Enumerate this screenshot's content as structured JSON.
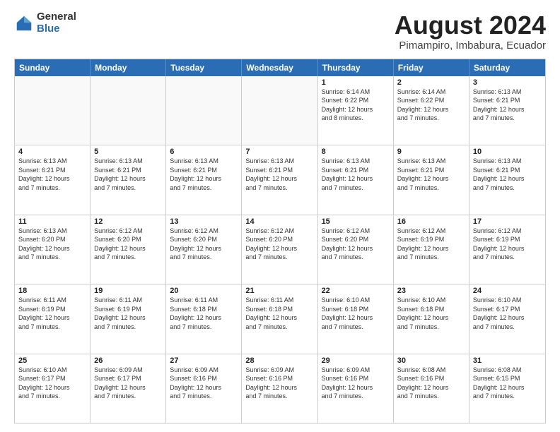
{
  "logo": {
    "general": "General",
    "blue": "Blue"
  },
  "title": "August 2024",
  "subtitle": "Pimampiro, Imbabura, Ecuador",
  "header_days": [
    "Sunday",
    "Monday",
    "Tuesday",
    "Wednesday",
    "Thursday",
    "Friday",
    "Saturday"
  ],
  "weeks": [
    [
      {
        "day": "",
        "lines": [],
        "empty": true
      },
      {
        "day": "",
        "lines": [],
        "empty": true
      },
      {
        "day": "",
        "lines": [],
        "empty": true
      },
      {
        "day": "",
        "lines": [],
        "empty": true
      },
      {
        "day": "1",
        "lines": [
          "Sunrise: 6:14 AM",
          "Sunset: 6:22 PM",
          "Daylight: 12 hours",
          "and 8 minutes."
        ],
        "empty": false
      },
      {
        "day": "2",
        "lines": [
          "Sunrise: 6:14 AM",
          "Sunset: 6:22 PM",
          "Daylight: 12 hours",
          "and 7 minutes."
        ],
        "empty": false
      },
      {
        "day": "3",
        "lines": [
          "Sunrise: 6:13 AM",
          "Sunset: 6:21 PM",
          "Daylight: 12 hours",
          "and 7 minutes."
        ],
        "empty": false
      }
    ],
    [
      {
        "day": "4",
        "lines": [
          "Sunrise: 6:13 AM",
          "Sunset: 6:21 PM",
          "Daylight: 12 hours",
          "and 7 minutes."
        ],
        "empty": false
      },
      {
        "day": "5",
        "lines": [
          "Sunrise: 6:13 AM",
          "Sunset: 6:21 PM",
          "Daylight: 12 hours",
          "and 7 minutes."
        ],
        "empty": false
      },
      {
        "day": "6",
        "lines": [
          "Sunrise: 6:13 AM",
          "Sunset: 6:21 PM",
          "Daylight: 12 hours",
          "and 7 minutes."
        ],
        "empty": false
      },
      {
        "day": "7",
        "lines": [
          "Sunrise: 6:13 AM",
          "Sunset: 6:21 PM",
          "Daylight: 12 hours",
          "and 7 minutes."
        ],
        "empty": false
      },
      {
        "day": "8",
        "lines": [
          "Sunrise: 6:13 AM",
          "Sunset: 6:21 PM",
          "Daylight: 12 hours",
          "and 7 minutes."
        ],
        "empty": false
      },
      {
        "day": "9",
        "lines": [
          "Sunrise: 6:13 AM",
          "Sunset: 6:21 PM",
          "Daylight: 12 hours",
          "and 7 minutes."
        ],
        "empty": false
      },
      {
        "day": "10",
        "lines": [
          "Sunrise: 6:13 AM",
          "Sunset: 6:21 PM",
          "Daylight: 12 hours",
          "and 7 minutes."
        ],
        "empty": false
      }
    ],
    [
      {
        "day": "11",
        "lines": [
          "Sunrise: 6:13 AM",
          "Sunset: 6:20 PM",
          "Daylight: 12 hours",
          "and 7 minutes."
        ],
        "empty": false
      },
      {
        "day": "12",
        "lines": [
          "Sunrise: 6:12 AM",
          "Sunset: 6:20 PM",
          "Daylight: 12 hours",
          "and 7 minutes."
        ],
        "empty": false
      },
      {
        "day": "13",
        "lines": [
          "Sunrise: 6:12 AM",
          "Sunset: 6:20 PM",
          "Daylight: 12 hours",
          "and 7 minutes."
        ],
        "empty": false
      },
      {
        "day": "14",
        "lines": [
          "Sunrise: 6:12 AM",
          "Sunset: 6:20 PM",
          "Daylight: 12 hours",
          "and 7 minutes."
        ],
        "empty": false
      },
      {
        "day": "15",
        "lines": [
          "Sunrise: 6:12 AM",
          "Sunset: 6:20 PM",
          "Daylight: 12 hours",
          "and 7 minutes."
        ],
        "empty": false
      },
      {
        "day": "16",
        "lines": [
          "Sunrise: 6:12 AM",
          "Sunset: 6:19 PM",
          "Daylight: 12 hours",
          "and 7 minutes."
        ],
        "empty": false
      },
      {
        "day": "17",
        "lines": [
          "Sunrise: 6:12 AM",
          "Sunset: 6:19 PM",
          "Daylight: 12 hours",
          "and 7 minutes."
        ],
        "empty": false
      }
    ],
    [
      {
        "day": "18",
        "lines": [
          "Sunrise: 6:11 AM",
          "Sunset: 6:19 PM",
          "Daylight: 12 hours",
          "and 7 minutes."
        ],
        "empty": false
      },
      {
        "day": "19",
        "lines": [
          "Sunrise: 6:11 AM",
          "Sunset: 6:19 PM",
          "Daylight: 12 hours",
          "and 7 minutes."
        ],
        "empty": false
      },
      {
        "day": "20",
        "lines": [
          "Sunrise: 6:11 AM",
          "Sunset: 6:18 PM",
          "Daylight: 12 hours",
          "and 7 minutes."
        ],
        "empty": false
      },
      {
        "day": "21",
        "lines": [
          "Sunrise: 6:11 AM",
          "Sunset: 6:18 PM",
          "Daylight: 12 hours",
          "and 7 minutes."
        ],
        "empty": false
      },
      {
        "day": "22",
        "lines": [
          "Sunrise: 6:10 AM",
          "Sunset: 6:18 PM",
          "Daylight: 12 hours",
          "and 7 minutes."
        ],
        "empty": false
      },
      {
        "day": "23",
        "lines": [
          "Sunrise: 6:10 AM",
          "Sunset: 6:18 PM",
          "Daylight: 12 hours",
          "and 7 minutes."
        ],
        "empty": false
      },
      {
        "day": "24",
        "lines": [
          "Sunrise: 6:10 AM",
          "Sunset: 6:17 PM",
          "Daylight: 12 hours",
          "and 7 minutes."
        ],
        "empty": false
      }
    ],
    [
      {
        "day": "25",
        "lines": [
          "Sunrise: 6:10 AM",
          "Sunset: 6:17 PM",
          "Daylight: 12 hours",
          "and 7 minutes."
        ],
        "empty": false
      },
      {
        "day": "26",
        "lines": [
          "Sunrise: 6:09 AM",
          "Sunset: 6:17 PM",
          "Daylight: 12 hours",
          "and 7 minutes."
        ],
        "empty": false
      },
      {
        "day": "27",
        "lines": [
          "Sunrise: 6:09 AM",
          "Sunset: 6:16 PM",
          "Daylight: 12 hours",
          "and 7 minutes."
        ],
        "empty": false
      },
      {
        "day": "28",
        "lines": [
          "Sunrise: 6:09 AM",
          "Sunset: 6:16 PM",
          "Daylight: 12 hours",
          "and 7 minutes."
        ],
        "empty": false
      },
      {
        "day": "29",
        "lines": [
          "Sunrise: 6:09 AM",
          "Sunset: 6:16 PM",
          "Daylight: 12 hours",
          "and 7 minutes."
        ],
        "empty": false
      },
      {
        "day": "30",
        "lines": [
          "Sunrise: 6:08 AM",
          "Sunset: 6:16 PM",
          "Daylight: 12 hours",
          "and 7 minutes."
        ],
        "empty": false
      },
      {
        "day": "31",
        "lines": [
          "Sunrise: 6:08 AM",
          "Sunset: 6:15 PM",
          "Daylight: 12 hours",
          "and 7 minutes."
        ],
        "empty": false
      }
    ]
  ]
}
